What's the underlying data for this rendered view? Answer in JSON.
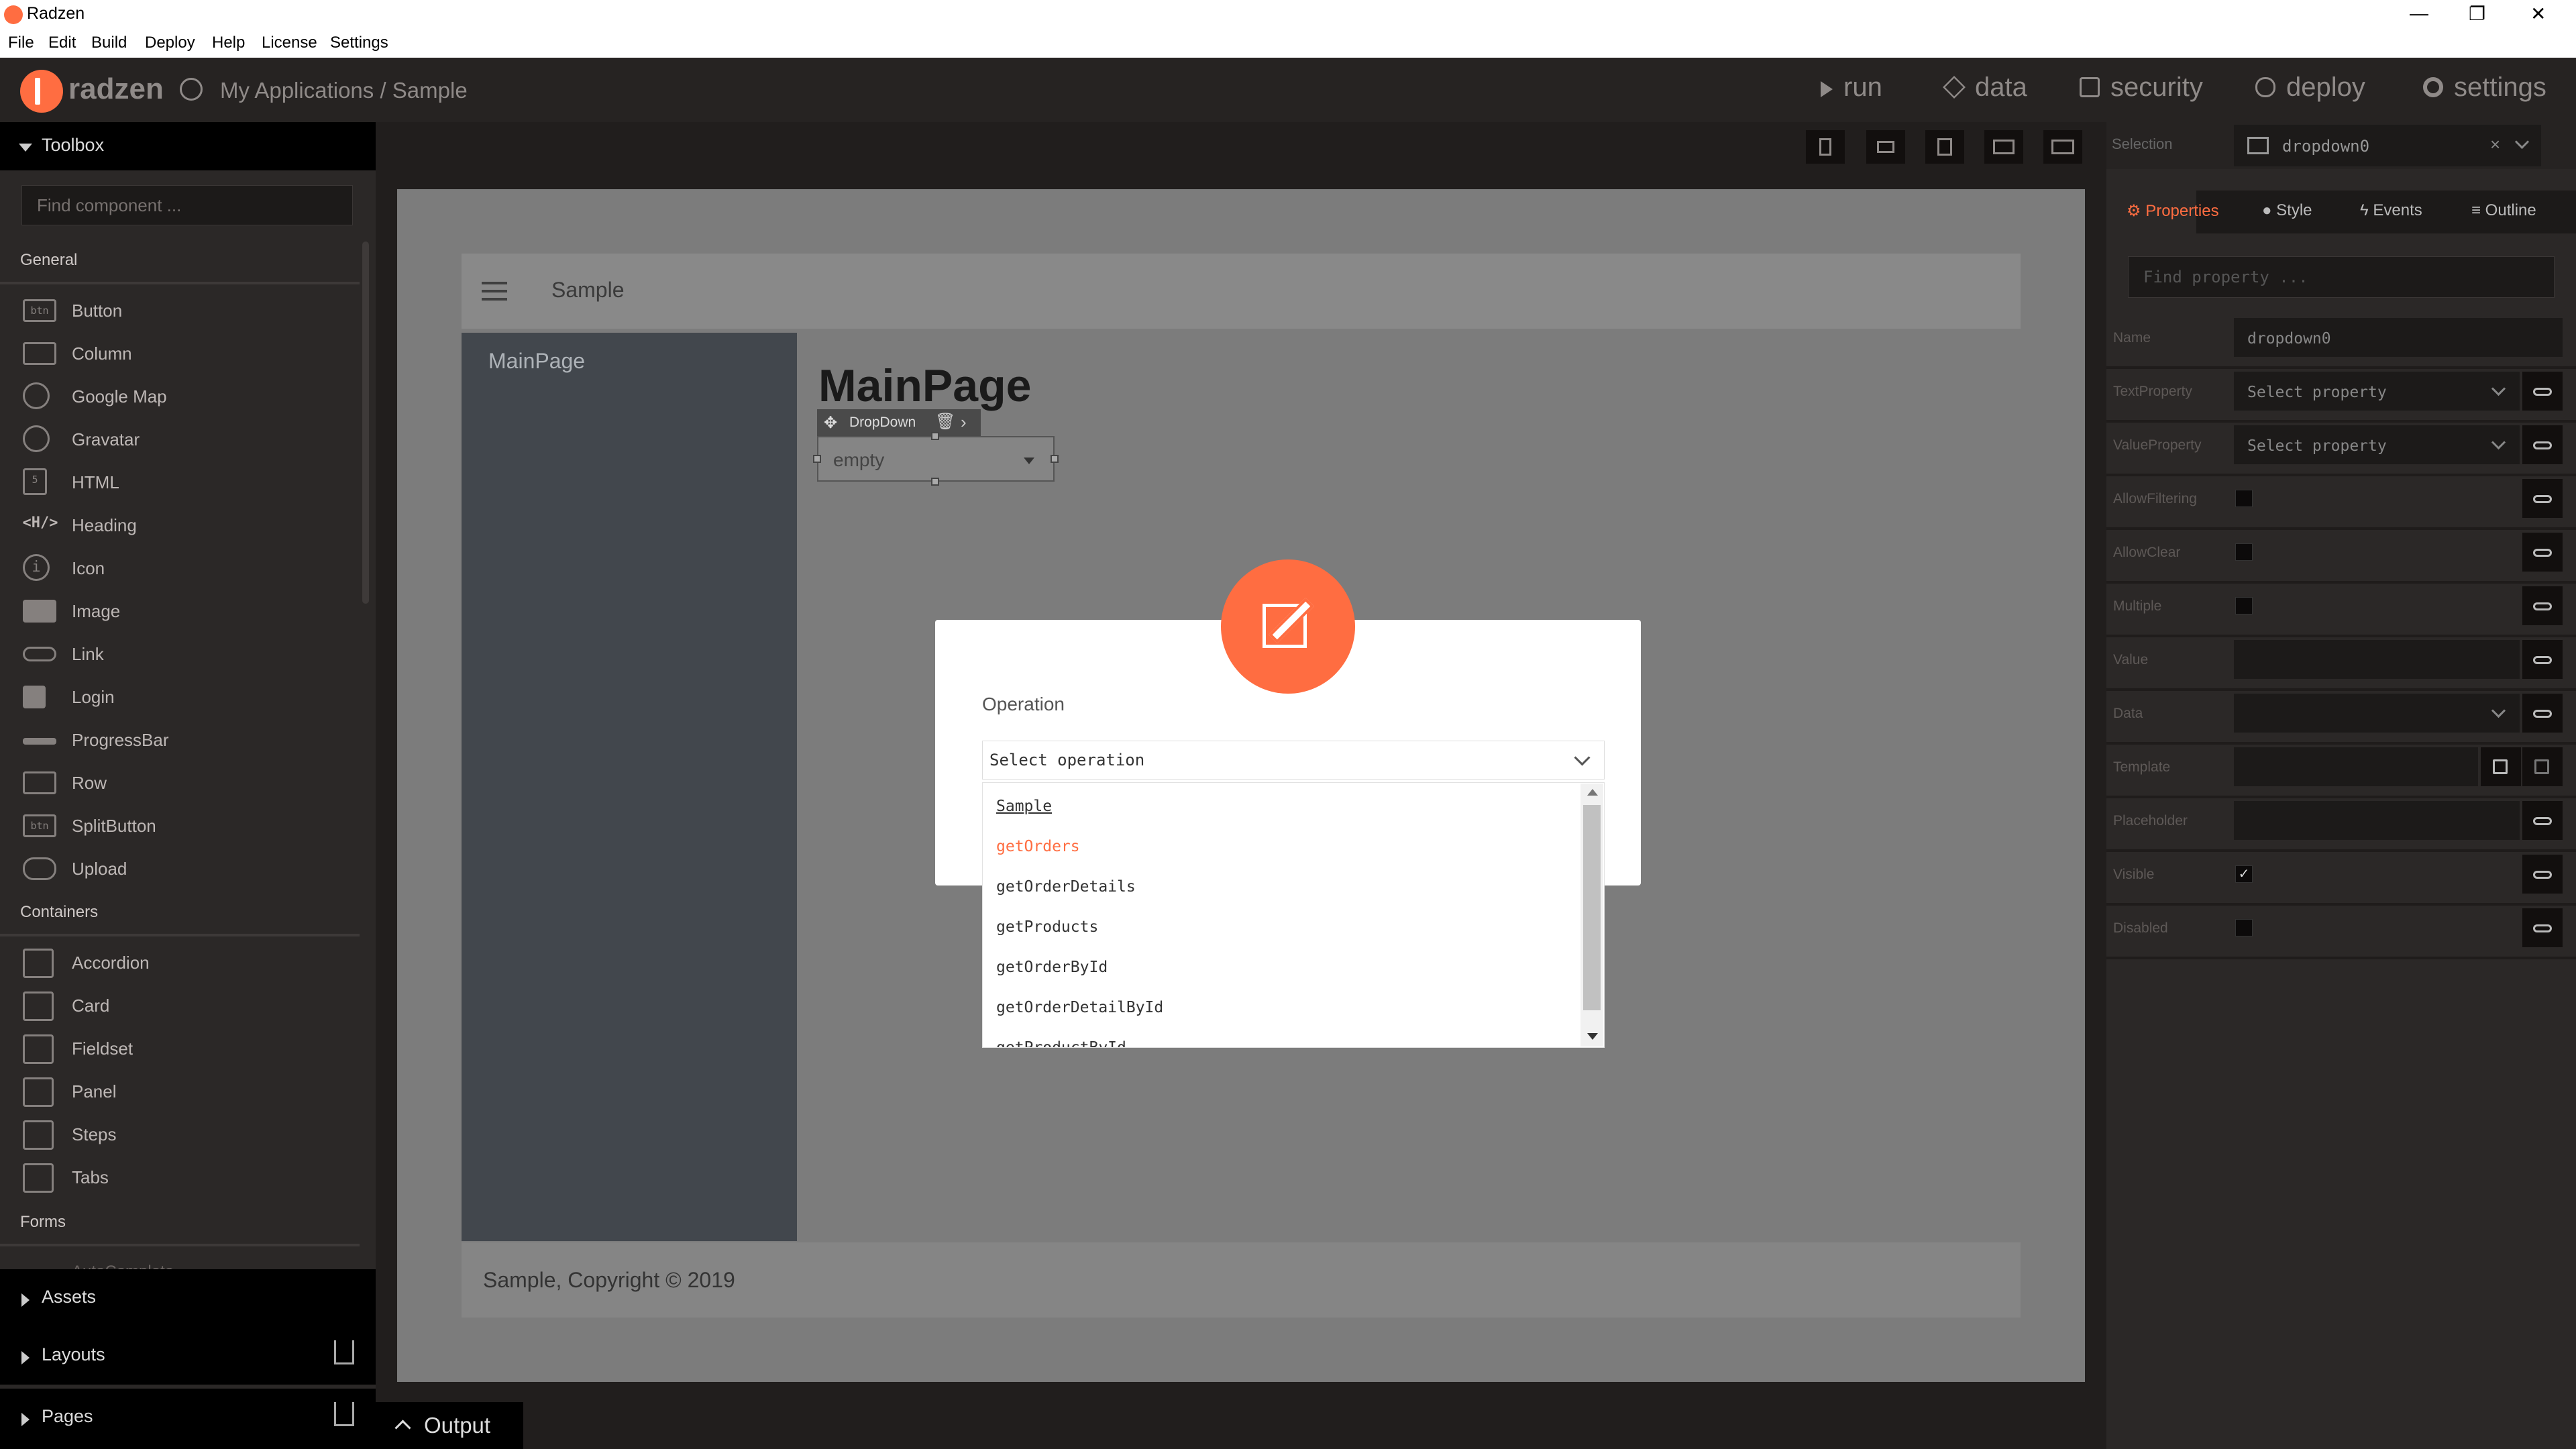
{
  "window": {
    "title": "Radzen",
    "minimize": "—",
    "restore": "❐",
    "close": "✕"
  },
  "menu": [
    "File",
    "Edit",
    "Build",
    "Deploy",
    "Help",
    "License",
    "Settings"
  ],
  "header": {
    "brand": "radzen",
    "breadcrumb": "My Applications / Sample",
    "nav": [
      "run",
      "data",
      "security",
      "deploy",
      "settings"
    ]
  },
  "toolbox": {
    "title": "Toolbox",
    "search_placeholder": "Find component ...",
    "sections": {
      "general": "General",
      "containers": "Containers",
      "forms": "Forms"
    },
    "general_items": [
      {
        "label": "Button",
        "icon": "btn"
      },
      {
        "label": "Column",
        "icon": ""
      },
      {
        "label": "Google Map",
        "icon": ""
      },
      {
        "label": "Gravatar",
        "icon": ""
      },
      {
        "label": "HTML",
        "icon": "5"
      },
      {
        "label": "Heading",
        "icon": "<H/>"
      },
      {
        "label": "Icon",
        "icon": "i"
      },
      {
        "label": "Image",
        "icon": ""
      },
      {
        "label": "Link",
        "icon": ""
      },
      {
        "label": "Login",
        "icon": ""
      },
      {
        "label": "ProgressBar",
        "icon": ""
      },
      {
        "label": "Row",
        "icon": ""
      },
      {
        "label": "SplitButton",
        "icon": "btn"
      },
      {
        "label": "Upload",
        "icon": ""
      }
    ],
    "container_items": [
      "Accordion",
      "Card",
      "Fieldset",
      "Panel",
      "Steps",
      "Tabs"
    ],
    "forms_partial": "AutoComplete",
    "bottom": [
      "Assets",
      "Layouts",
      "Pages"
    ]
  },
  "design": {
    "header_title": "Sample",
    "sidebar_item": "MainPage",
    "heading": "MainPage",
    "dropdown_toolbar": "DropDown",
    "dropdown_value": "empty",
    "footer": "Sample, Copyright © 2019"
  },
  "dialog": {
    "label": "Operation",
    "select_placeholder": "Select operation",
    "options": [
      "Sample",
      "getOrders",
      "getOrderDetails",
      "getProducts",
      "getOrderById",
      "getOrderDetailById",
      "getProductById"
    ],
    "highlight_color": "#ff6d41"
  },
  "panel": {
    "selection_label": "Selection",
    "selection_value": "dropdown0",
    "tabs": [
      "Properties",
      "Style",
      "Events",
      "Outline"
    ],
    "find_placeholder": "Find property ...",
    "props": [
      {
        "label": "Name",
        "type": "text",
        "value": "dropdown0"
      },
      {
        "label": "TextProperty",
        "type": "select",
        "value": "Select property"
      },
      {
        "label": "ValueProperty",
        "type": "select",
        "value": "Select property"
      },
      {
        "label": "AllowFiltering",
        "type": "checkbox",
        "value": ""
      },
      {
        "label": "AllowClear",
        "type": "checkbox",
        "value": ""
      },
      {
        "label": "Multiple",
        "type": "checkbox",
        "value": ""
      },
      {
        "label": "Value",
        "type": "text",
        "value": ""
      },
      {
        "label": "Data",
        "type": "select",
        "value": ""
      },
      {
        "label": "Template",
        "type": "template",
        "value": ""
      },
      {
        "label": "Placeholder",
        "type": "text",
        "value": ""
      },
      {
        "label": "Visible",
        "type": "checked",
        "value": "✓"
      },
      {
        "label": "Disabled",
        "type": "checkbox",
        "value": ""
      }
    ]
  },
  "output": {
    "label": "Output"
  },
  "colors": {
    "accent": "#ff6d41",
    "dark": "#211e1d"
  }
}
